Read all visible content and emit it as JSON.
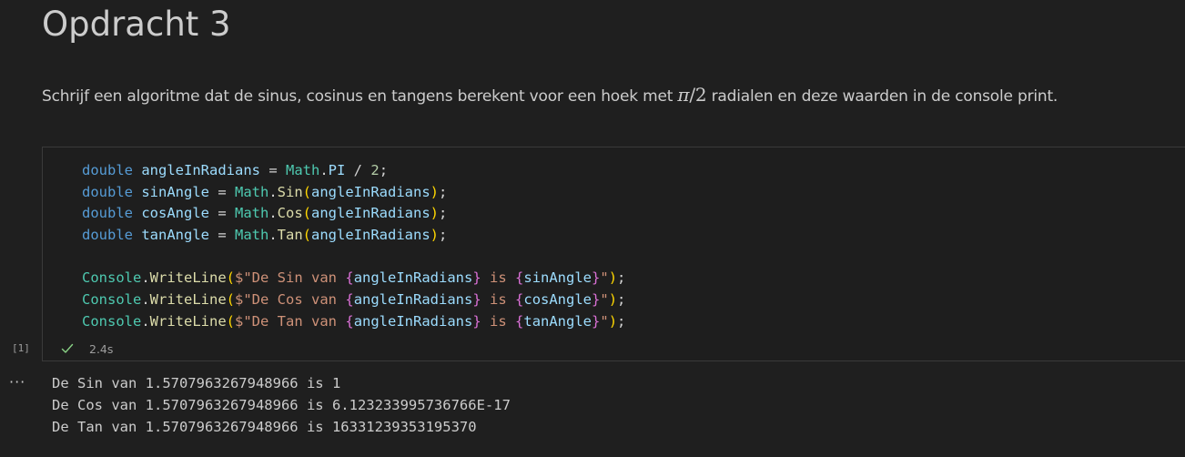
{
  "markdown": {
    "title": "Opdracht 3",
    "para_before": "Schrijf een algoritme dat de sinus, cosinus en tangens berekent voor een hoek met ",
    "math_pi": "π",
    "math_rest": "/2",
    "para_after": " radialen en deze waarden in de console print."
  },
  "code": {
    "l1": {
      "kw": "double",
      "var": "angleInRadians",
      "eq": " = ",
      "cls": "Math",
      "dot": ".",
      "prop": "PI",
      "op": " / ",
      "num": "2",
      "end": ";"
    },
    "l2": {
      "kw": "double",
      "var": "sinAngle",
      "eq": " = ",
      "cls": "Math",
      "dot": ".",
      "fn": "Sin",
      "open": "(",
      "arg": "angleInRadians",
      "close": ")",
      "end": ";"
    },
    "l3": {
      "kw": "double",
      "var": "cosAngle",
      "eq": " = ",
      "cls": "Math",
      "dot": ".",
      "fn": "Cos",
      "open": "(",
      "arg": "angleInRadians",
      "close": ")",
      "end": ";"
    },
    "l4": {
      "kw": "double",
      "var": "tanAngle",
      "eq": " = ",
      "cls": "Math",
      "dot": ".",
      "fn": "Tan",
      "open": "(",
      "arg": "angleInRadians",
      "close": ")",
      "end": ";"
    },
    "l6": {
      "cls": "Console",
      "dot": ".",
      "fn": "WriteLine",
      "open": "(",
      "str1": "$\"De Sin van ",
      "lb1": "{",
      "v1": "angleInRadians",
      "rb1": "}",
      "str2": " is ",
      "lb2": "{",
      "v2": "sinAngle",
      "rb2": "}",
      "str3": "\"",
      "close": ")",
      "end": ";"
    },
    "l7": {
      "cls": "Console",
      "dot": ".",
      "fn": "WriteLine",
      "open": "(",
      "str1": "$\"De Cos van ",
      "lb1": "{",
      "v1": "angleInRadians",
      "rb1": "}",
      "str2": " is ",
      "lb2": "{",
      "v2": "cosAngle",
      "rb2": "}",
      "str3": "\"",
      "close": ")",
      "end": ";"
    },
    "l8": {
      "cls": "Console",
      "dot": ".",
      "fn": "WriteLine",
      "open": "(",
      "str1": "$\"De Tan van ",
      "lb1": "{",
      "v1": "angleInRadians",
      "rb1": "}",
      "str2": " is ",
      "lb2": "{",
      "v2": "tanAngle",
      "rb2": "}",
      "str3": "\"",
      "close": ")",
      "end": ";"
    }
  },
  "cell": {
    "execution_count": "[1]",
    "status_icon": "check-icon",
    "duration": "2.4s"
  },
  "output": {
    "menu": "···",
    "lines": [
      "De Sin van 1.5707963267948966 is 1",
      "De Cos van 1.5707963267948966 is 6.123233995736766E-17",
      "De Tan van 1.5707963267948966 is 16331239353195370"
    ]
  },
  "colors": {
    "background": "#1f1f1f",
    "keyword": "#569cd6",
    "variable": "#9cdcfe",
    "class": "#4ec9b0",
    "function": "#dcdcaa",
    "string": "#ce9178",
    "bracket": "#ffd700",
    "interpolation_brace": "#da70d6",
    "success": "#89d185"
  }
}
